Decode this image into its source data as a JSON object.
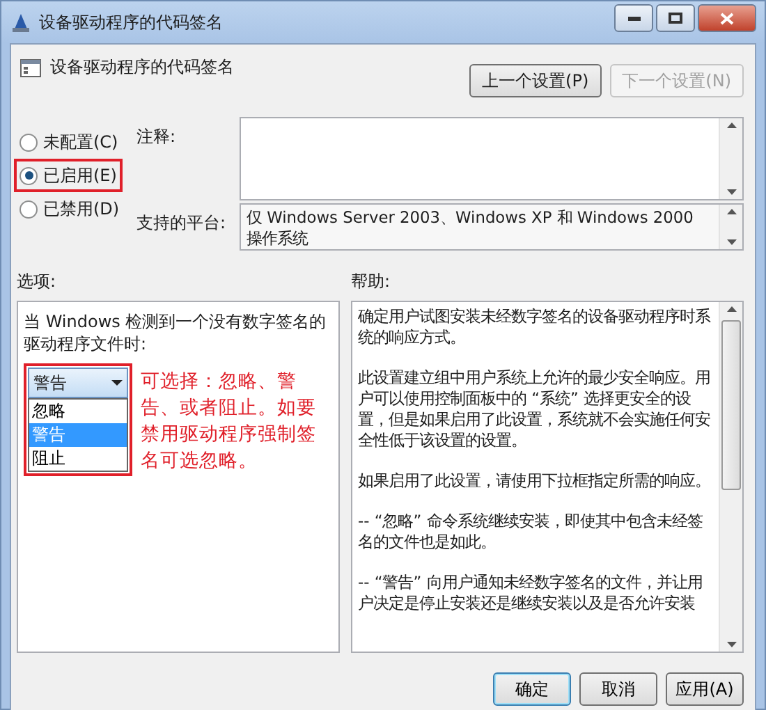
{
  "window": {
    "title": "设备驱动程序的代码签名"
  },
  "header": {
    "title": "设备驱动程序的代码签名",
    "buttons": [
      {
        "label": "上一个设置(P)",
        "disabled": false
      },
      {
        "label": "下一个设置(N)",
        "disabled": true
      }
    ]
  },
  "state_options": [
    {
      "label": "未配置(C)",
      "selected": false,
      "highlighted": false
    },
    {
      "label": "已启用(E)",
      "selected": true,
      "highlighted": true
    },
    {
      "label": "已禁用(D)",
      "selected": false,
      "highlighted": false
    }
  ],
  "comment": {
    "label": "注释:"
  },
  "platform": {
    "label": "支持的平台:",
    "value": "仅 Windows Server 2003、Windows XP 和 Windows 2000 操作系统"
  },
  "options": {
    "label": "选项:",
    "prompt": "当 Windows 检测到一个没有数字签名的驱动程序文件时:",
    "dropdown": {
      "value": "警告",
      "items": [
        {
          "label": "忽略",
          "selected": false
        },
        {
          "label": "警告",
          "selected": true
        },
        {
          "label": "阻止",
          "selected": false
        }
      ]
    },
    "annotation": "可选择：忽略、警告、或者阻止。如要禁用驱动程序强制签名可选忽略。"
  },
  "help": {
    "label": "帮助:",
    "paragraphs": [
      "确定用户试图安装未经数字签名的设备驱动程序时系统的响应方式。",
      "此设置建立组中用户系统上允许的最少安全响应。用户可以使用控制面板中的 “系统” 选择更安全的设置，但是如果启用了此设置，系统就不会实施任何安全性低于该设置的设置。",
      "如果启用了此设置，请使用下拉框指定所需的响应。",
      "-- “忽略” 命令系统继续安装，即使其中包含未经签名的文件也是如此。",
      "-- “警告” 向用户通知未经数字签名的文件，并让用户决定是停止安装还是继续安装以及是否允许安装"
    ]
  },
  "buttons": [
    {
      "label": "确定",
      "default": true
    },
    {
      "label": "取消",
      "default": false
    },
    {
      "label": "应用(A)",
      "default": false
    }
  ]
}
